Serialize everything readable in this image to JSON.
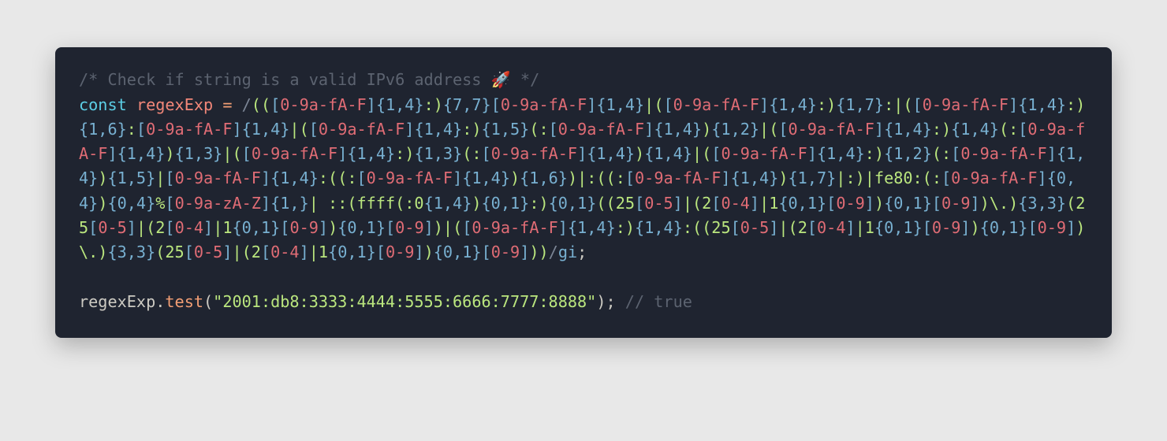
{
  "code": {
    "tokens": [
      {
        "cls": "c-comment",
        "t": "/* Check if string is a valid IPv6 address "
      },
      {
        "cls": "c-emoji",
        "t": "🚀 "
      },
      {
        "cls": "c-comment",
        "t": "*/"
      },
      {
        "cls": "",
        "t": "\n"
      },
      {
        "cls": "c-kw",
        "t": "const"
      },
      {
        "cls": "",
        "t": " "
      },
      {
        "cls": "c-var",
        "t": "regexExp"
      },
      {
        "cls": "",
        "t": " "
      },
      {
        "cls": "c-eq",
        "t": "="
      },
      {
        "cls": "",
        "t": " "
      },
      {
        "cls": "c-delim",
        "t": "/"
      },
      {
        "cls": "c-regex",
        "t": "(("
      },
      {
        "cls": "c-brack",
        "t": "["
      },
      {
        "cls": "c-range",
        "t": "0-9a-fA-F"
      },
      {
        "cls": "c-brack",
        "t": "]"
      },
      {
        "cls": "c-num",
        "t": "{1,4}"
      },
      {
        "cls": "c-regex",
        "t": ":)"
      },
      {
        "cls": "c-num",
        "t": "{7,7}"
      },
      {
        "cls": "c-brack",
        "t": "["
      },
      {
        "cls": "c-range",
        "t": "0-9a-fA-F"
      },
      {
        "cls": "c-brack",
        "t": "]"
      },
      {
        "cls": "c-num",
        "t": "{1,4}"
      },
      {
        "cls": "c-regex",
        "t": "|("
      },
      {
        "cls": "c-brack",
        "t": "["
      },
      {
        "cls": "c-range",
        "t": "0-9a-fA-F"
      },
      {
        "cls": "c-brack",
        "t": "]"
      },
      {
        "cls": "c-num",
        "t": "{1,4}"
      },
      {
        "cls": "c-regex",
        "t": ":)"
      },
      {
        "cls": "c-num",
        "t": "{1,7}"
      },
      {
        "cls": "c-regex",
        "t": ":|("
      },
      {
        "cls": "c-brack",
        "t": "["
      },
      {
        "cls": "c-range",
        "t": "0-9a-fA-F"
      },
      {
        "cls": "c-brack",
        "t": "]"
      },
      {
        "cls": "c-num",
        "t": "{1,4}"
      },
      {
        "cls": "c-regex",
        "t": ":)"
      },
      {
        "cls": "c-num",
        "t": "{1,6}"
      },
      {
        "cls": "c-regex",
        "t": ":"
      },
      {
        "cls": "c-brack",
        "t": "["
      },
      {
        "cls": "c-range",
        "t": "0-9a-fA-F"
      },
      {
        "cls": "c-brack",
        "t": "]"
      },
      {
        "cls": "c-num",
        "t": "{1,4}"
      },
      {
        "cls": "c-regex",
        "t": "|("
      },
      {
        "cls": "c-brack",
        "t": "["
      },
      {
        "cls": "c-range",
        "t": "0-9a-fA-F"
      },
      {
        "cls": "c-brack",
        "t": "]"
      },
      {
        "cls": "c-num",
        "t": "{1,4}"
      },
      {
        "cls": "c-regex",
        "t": ":)"
      },
      {
        "cls": "c-num",
        "t": "{1,5}"
      },
      {
        "cls": "c-regex",
        "t": "(:"
      },
      {
        "cls": "c-brack",
        "t": "["
      },
      {
        "cls": "c-range",
        "t": "0-9a-fA-F"
      },
      {
        "cls": "c-brack",
        "t": "]"
      },
      {
        "cls": "c-num",
        "t": "{1,4}"
      },
      {
        "cls": "c-regex",
        "t": ")"
      },
      {
        "cls": "c-num",
        "t": "{1,2}"
      },
      {
        "cls": "c-regex",
        "t": "|("
      },
      {
        "cls": "c-brack",
        "t": "["
      },
      {
        "cls": "c-range",
        "t": "0-9a-fA-F"
      },
      {
        "cls": "c-brack",
        "t": "]"
      },
      {
        "cls": "c-num",
        "t": "{1,4}"
      },
      {
        "cls": "c-regex",
        "t": ":)"
      },
      {
        "cls": "c-num",
        "t": "{1,4}"
      },
      {
        "cls": "c-regex",
        "t": "(:"
      },
      {
        "cls": "c-brack",
        "t": "["
      },
      {
        "cls": "c-range",
        "t": "0-9a-fA-F"
      },
      {
        "cls": "c-brack",
        "t": "]"
      },
      {
        "cls": "c-num",
        "t": "{1,4}"
      },
      {
        "cls": "c-regex",
        "t": ")"
      },
      {
        "cls": "c-num",
        "t": "{1,3}"
      },
      {
        "cls": "c-regex",
        "t": "|("
      },
      {
        "cls": "c-brack",
        "t": "["
      },
      {
        "cls": "c-range",
        "t": "0-9a-fA-F"
      },
      {
        "cls": "c-brack",
        "t": "]"
      },
      {
        "cls": "c-num",
        "t": "{1,4}"
      },
      {
        "cls": "c-regex",
        "t": ":)"
      },
      {
        "cls": "c-num",
        "t": "{1,3}"
      },
      {
        "cls": "c-regex",
        "t": "(:"
      },
      {
        "cls": "c-brack",
        "t": "["
      },
      {
        "cls": "c-range",
        "t": "0-9a-fA-F"
      },
      {
        "cls": "c-brack",
        "t": "]"
      },
      {
        "cls": "c-num",
        "t": "{1,4}"
      },
      {
        "cls": "c-regex",
        "t": ")"
      },
      {
        "cls": "c-num",
        "t": "{1,4}"
      },
      {
        "cls": "c-regex",
        "t": "|("
      },
      {
        "cls": "c-brack",
        "t": "["
      },
      {
        "cls": "c-range",
        "t": "0-9a-fA-F"
      },
      {
        "cls": "c-brack",
        "t": "]"
      },
      {
        "cls": "c-num",
        "t": "{1,4}"
      },
      {
        "cls": "c-regex",
        "t": ":)"
      },
      {
        "cls": "c-num",
        "t": "{1,2}"
      },
      {
        "cls": "c-regex",
        "t": "(:"
      },
      {
        "cls": "c-brack",
        "t": "["
      },
      {
        "cls": "c-range",
        "t": "0-9a-fA-F"
      },
      {
        "cls": "c-brack",
        "t": "]"
      },
      {
        "cls": "c-num",
        "t": "{1,4}"
      },
      {
        "cls": "c-regex",
        "t": ")"
      },
      {
        "cls": "c-num",
        "t": "{1,5}"
      },
      {
        "cls": "c-regex",
        "t": "|"
      },
      {
        "cls": "c-brack",
        "t": "["
      },
      {
        "cls": "c-range",
        "t": "0-9a-fA-F"
      },
      {
        "cls": "c-brack",
        "t": "]"
      },
      {
        "cls": "c-num",
        "t": "{1,4}"
      },
      {
        "cls": "c-regex",
        "t": ":((:"
      },
      {
        "cls": "c-brack",
        "t": "["
      },
      {
        "cls": "c-range",
        "t": "0-9a-fA-F"
      },
      {
        "cls": "c-brack",
        "t": "]"
      },
      {
        "cls": "c-num",
        "t": "{1,4}"
      },
      {
        "cls": "c-regex",
        "t": ")"
      },
      {
        "cls": "c-num",
        "t": "{1,6}"
      },
      {
        "cls": "c-regex",
        "t": ")|:((:"
      },
      {
        "cls": "c-brack",
        "t": "["
      },
      {
        "cls": "c-range",
        "t": "0-9a-fA-F"
      },
      {
        "cls": "c-brack",
        "t": "]"
      },
      {
        "cls": "c-num",
        "t": "{1,4}"
      },
      {
        "cls": "c-regex",
        "t": ")"
      },
      {
        "cls": "c-num",
        "t": "{1,7}"
      },
      {
        "cls": "c-regex",
        "t": "|:)|fe80:(:"
      },
      {
        "cls": "c-brack",
        "t": "["
      },
      {
        "cls": "c-range",
        "t": "0-9a-fA-F"
      },
      {
        "cls": "c-brack",
        "t": "]"
      },
      {
        "cls": "c-num",
        "t": "{0,4}"
      },
      {
        "cls": "c-regex",
        "t": ")"
      },
      {
        "cls": "c-num",
        "t": "{0,4}"
      },
      {
        "cls": "c-regex",
        "t": "%"
      },
      {
        "cls": "c-brack",
        "t": "["
      },
      {
        "cls": "c-range",
        "t": "0-9a-zA-Z"
      },
      {
        "cls": "c-brack",
        "t": "]"
      },
      {
        "cls": "c-num",
        "t": "{1,}"
      },
      {
        "cls": "c-regex",
        "t": "| ::(ffff(:0"
      },
      {
        "cls": "c-num",
        "t": "{1,4}"
      },
      {
        "cls": "c-regex",
        "t": ")"
      },
      {
        "cls": "c-num",
        "t": "{0,1}"
      },
      {
        "cls": "c-regex",
        "t": ":)"
      },
      {
        "cls": "c-num",
        "t": "{0,1}"
      },
      {
        "cls": "c-regex",
        "t": "((25"
      },
      {
        "cls": "c-brack",
        "t": "["
      },
      {
        "cls": "c-range",
        "t": "0-5"
      },
      {
        "cls": "c-brack",
        "t": "]"
      },
      {
        "cls": "c-regex",
        "t": "|(2"
      },
      {
        "cls": "c-brack",
        "t": "["
      },
      {
        "cls": "c-range",
        "t": "0-4"
      },
      {
        "cls": "c-brack",
        "t": "]"
      },
      {
        "cls": "c-regex",
        "t": "|1"
      },
      {
        "cls": "c-num",
        "t": "{0,1}"
      },
      {
        "cls": "c-brack",
        "t": "["
      },
      {
        "cls": "c-range",
        "t": "0-9"
      },
      {
        "cls": "c-brack",
        "t": "]"
      },
      {
        "cls": "c-regex",
        "t": ")"
      },
      {
        "cls": "c-num",
        "t": "{0,1}"
      },
      {
        "cls": "c-brack",
        "t": "["
      },
      {
        "cls": "c-range",
        "t": "0-9"
      },
      {
        "cls": "c-brack",
        "t": "]"
      },
      {
        "cls": "c-regex",
        "t": ")\\.)"
      },
      {
        "cls": "c-num",
        "t": "{3,3}"
      },
      {
        "cls": "c-regex",
        "t": "(25"
      },
      {
        "cls": "c-brack",
        "t": "["
      },
      {
        "cls": "c-range",
        "t": "0-5"
      },
      {
        "cls": "c-brack",
        "t": "]"
      },
      {
        "cls": "c-regex",
        "t": "|(2"
      },
      {
        "cls": "c-brack",
        "t": "["
      },
      {
        "cls": "c-range",
        "t": "0-4"
      },
      {
        "cls": "c-brack",
        "t": "]"
      },
      {
        "cls": "c-regex",
        "t": "|1"
      },
      {
        "cls": "c-num",
        "t": "{0,1}"
      },
      {
        "cls": "c-brack",
        "t": "["
      },
      {
        "cls": "c-range",
        "t": "0-9"
      },
      {
        "cls": "c-brack",
        "t": "]"
      },
      {
        "cls": "c-regex",
        "t": ")"
      },
      {
        "cls": "c-num",
        "t": "{0,1}"
      },
      {
        "cls": "c-brack",
        "t": "["
      },
      {
        "cls": "c-range",
        "t": "0-9"
      },
      {
        "cls": "c-brack",
        "t": "]"
      },
      {
        "cls": "c-regex",
        "t": ")|("
      },
      {
        "cls": "c-brack",
        "t": "["
      },
      {
        "cls": "c-range",
        "t": "0-9a-fA-F"
      },
      {
        "cls": "c-brack",
        "t": "]"
      },
      {
        "cls": "c-num",
        "t": "{1,4}"
      },
      {
        "cls": "c-regex",
        "t": ":)"
      },
      {
        "cls": "c-num",
        "t": "{1,4}"
      },
      {
        "cls": "c-regex",
        "t": ":((25"
      },
      {
        "cls": "c-brack",
        "t": "["
      },
      {
        "cls": "c-range",
        "t": "0-5"
      },
      {
        "cls": "c-brack",
        "t": "]"
      },
      {
        "cls": "c-regex",
        "t": "|(2"
      },
      {
        "cls": "c-brack",
        "t": "["
      },
      {
        "cls": "c-range",
        "t": "0-4"
      },
      {
        "cls": "c-brack",
        "t": "]"
      },
      {
        "cls": "c-regex",
        "t": "|1"
      },
      {
        "cls": "c-num",
        "t": "{0,1}"
      },
      {
        "cls": "c-brack",
        "t": "["
      },
      {
        "cls": "c-range",
        "t": "0-9"
      },
      {
        "cls": "c-brack",
        "t": "]"
      },
      {
        "cls": "c-regex",
        "t": ")"
      },
      {
        "cls": "c-num",
        "t": "{0,1}"
      },
      {
        "cls": "c-brack",
        "t": "["
      },
      {
        "cls": "c-range",
        "t": "0-9"
      },
      {
        "cls": "c-brack",
        "t": "]"
      },
      {
        "cls": "c-regex",
        "t": ")\\.)"
      },
      {
        "cls": "c-num",
        "t": "{3,3}"
      },
      {
        "cls": "c-regex",
        "t": "(25"
      },
      {
        "cls": "c-brack",
        "t": "["
      },
      {
        "cls": "c-range",
        "t": "0-5"
      },
      {
        "cls": "c-brack",
        "t": "]"
      },
      {
        "cls": "c-regex",
        "t": "|(2"
      },
      {
        "cls": "c-brack",
        "t": "["
      },
      {
        "cls": "c-range",
        "t": "0-4"
      },
      {
        "cls": "c-brack",
        "t": "]"
      },
      {
        "cls": "c-regex",
        "t": "|1"
      },
      {
        "cls": "c-num",
        "t": "{0,1}"
      },
      {
        "cls": "c-brack",
        "t": "["
      },
      {
        "cls": "c-range",
        "t": "0-9"
      },
      {
        "cls": "c-brack",
        "t": "]"
      },
      {
        "cls": "c-regex",
        "t": ")"
      },
      {
        "cls": "c-num",
        "t": "{0,1}"
      },
      {
        "cls": "c-brack",
        "t": "["
      },
      {
        "cls": "c-range",
        "t": "0-9"
      },
      {
        "cls": "c-brack",
        "t": "]"
      },
      {
        "cls": "c-regex",
        "t": "))"
      },
      {
        "cls": "c-delim",
        "t": "/"
      },
      {
        "cls": "c-num",
        "t": "gi"
      },
      {
        "cls": "c-punct",
        "t": ";"
      },
      {
        "cls": "",
        "t": "\n\n"
      },
      {
        "cls": "c-punct",
        "t": "regexExp"
      },
      {
        "cls": "c-punct",
        "t": "."
      },
      {
        "cls": "c-fn",
        "t": "test"
      },
      {
        "cls": "c-punct",
        "t": "("
      },
      {
        "cls": "c-str",
        "t": "\"2001:db8:3333:4444:5555:6666:7777:8888\""
      },
      {
        "cls": "c-punct",
        "t": ");"
      },
      {
        "cls": "",
        "t": " "
      },
      {
        "cls": "c-comment",
        "t": "// true"
      }
    ]
  }
}
